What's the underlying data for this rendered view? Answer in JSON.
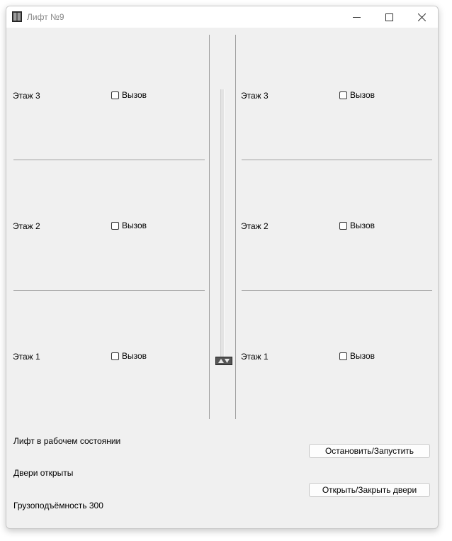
{
  "window": {
    "title": "Лифт №9"
  },
  "shafts": [
    {
      "floors": [
        {
          "label": "Этаж 3",
          "call": "Вызов"
        },
        {
          "label": "Этаж 2",
          "call": "Вызов"
        },
        {
          "label": "Этаж 1",
          "call": "Вызов"
        }
      ]
    },
    {
      "floors": [
        {
          "label": "Этаж 3",
          "call": "Вызов"
        },
        {
          "label": "Этаж 2",
          "call": "Вызов"
        },
        {
          "label": "Этаж 1",
          "call": "Вызов"
        }
      ]
    }
  ],
  "status": {
    "state": "Лифт в рабочем состоянии",
    "doors": "Двери открыты",
    "capacity": "Грузоподъёмность 300"
  },
  "buttons": {
    "stop_start": "Остановить/Запустить",
    "doors_toggle": "Открыть/Закрыть двери"
  },
  "icons": {
    "app": "elevator-icon",
    "minimize": "minimize-icon",
    "maximize": "maximize-icon",
    "close": "close-icon",
    "cabin_arrows": "up-down-arrows-icon"
  }
}
